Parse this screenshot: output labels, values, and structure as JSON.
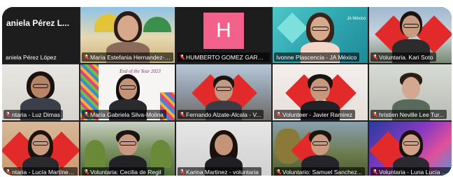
{
  "meeting": {
    "layout": "gallery",
    "colors": {
      "muted_icon": "#ff3b30",
      "active_border": "#e6d21a",
      "nameplate_bg": "rgba(0,0,0,0.6)"
    },
    "participants": [
      {
        "name": "aniela Pérez López",
        "big_name": "aniela Pérez L...",
        "muted": false,
        "video": false
      },
      {
        "name": "María Estefania Hernandez-Fu...",
        "muted": true,
        "video": true
      },
      {
        "name": "HUMBERTO GOMEZ GARCIA",
        "avatar_letter": "H",
        "muted": true,
        "video": false
      },
      {
        "name": "Ivonne Plascencia - JA México",
        "muted": false,
        "video": true,
        "active_speaker": true,
        "logo_text": "JA México"
      },
      {
        "name": "Voluntaria. Kari Soto",
        "muted": true,
        "video": true
      },
      {
        "name": "ntaria - Luz Dimas",
        "muted": true,
        "video": true
      },
      {
        "name": "María Gabriela Silva-Molina",
        "muted": true,
        "video": true,
        "banner_text": "End of the Year 2023"
      },
      {
        "name": "Fernando Alzate-Alcala - V...",
        "muted": true,
        "video": true
      },
      {
        "name": "Volunteer - Javier Ramirez",
        "muted": true,
        "video": true
      },
      {
        "name": "hristien Neville Lee Tur...",
        "muted": true,
        "video": true
      },
      {
        "name": "ntaria - Lucía Martínez ...",
        "muted": true,
        "video": true
      },
      {
        "name": "Voluntaria: Cecilia de Regil",
        "muted": true,
        "video": true
      },
      {
        "name": "Karina Martinez - voluntaria",
        "muted": true,
        "video": true
      },
      {
        "name": "Voluntario: Samuel Sanchez...",
        "muted": true,
        "video": true
      },
      {
        "name": "Voluntaria - Luna Lucía D...",
        "muted": true,
        "video": true
      }
    ]
  }
}
